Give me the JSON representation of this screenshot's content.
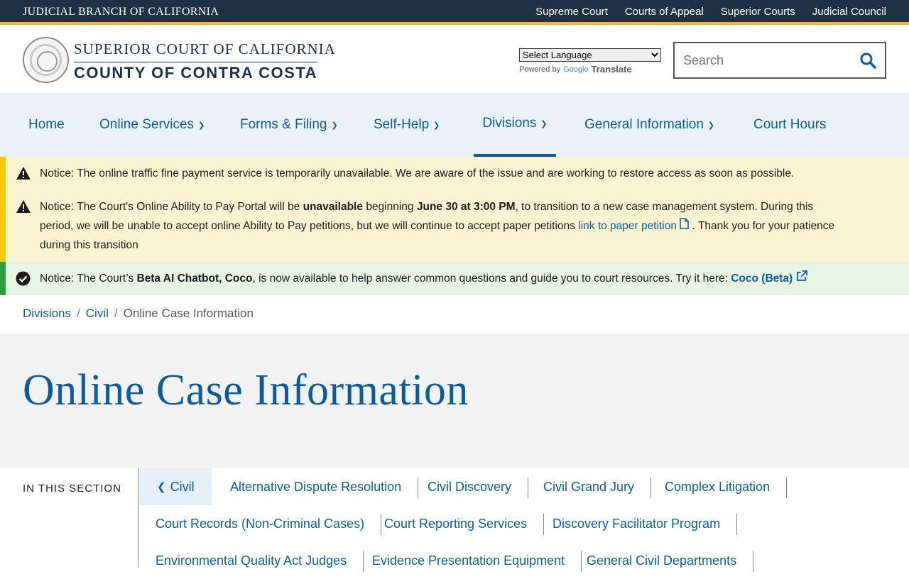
{
  "topbar": {
    "brand": "JUDICIAL BRANCH OF CALIFORNIA",
    "links": [
      "Supreme Court",
      "Courts of Appeal",
      "Superior Courts",
      "Judicial Council"
    ]
  },
  "header": {
    "court_line1": "SUPERIOR COURT OF CALIFORNIA",
    "court_line2": "COUNTY OF CONTRA COSTA",
    "language_select": "Select Language",
    "powered_by": "Powered by",
    "google": "Google",
    "translate": "Translate",
    "search_placeholder": "Search"
  },
  "nav": {
    "items": [
      "Home",
      "Online Services",
      "Forms & Filing",
      "Self-Help",
      "Divisions",
      "General Information",
      "Court Hours"
    ],
    "active": "Divisions"
  },
  "notices": {
    "n1": {
      "label": "Notice:",
      "text": "The online traffic fine payment service is temporarily unavailable. We are aware of the issue and are working to restore access as soon as possible."
    },
    "n2": {
      "label": "Notice:",
      "text_a": "The Court's Online Ability to Pay Portal will be",
      "bold1": "unavailable",
      "text_b": "beginning",
      "bold2": "June 30 at 3:00 PM",
      "text_c": ", to transition to a new case management system. During this period, we will be unable to accept online Ability to Pay petitions, but we will continue to accept paper petitions",
      "link": "link to paper petition",
      "text_d": ". Thank you for your patience during this transition"
    },
    "n3": {
      "label": "Notice:",
      "text_a": "The Court’s",
      "bold": "Beta AI Chatbot, Coco",
      "text_b": ", is now available to help answer common questions and guide you to court resources. Try it here:",
      "link": "Coco (Beta)"
    }
  },
  "breadcrumb": {
    "items": [
      "Divisions",
      "Civil",
      "Online Case Information"
    ]
  },
  "page_title": "Online Case Information",
  "in_this_section": {
    "label": "IN THIS SECTION",
    "back": "Civil",
    "links": [
      "Alternative Dispute Resolution",
      "Civil Discovery",
      "Civil Grand Jury",
      "Complex Litigation",
      "Court Records (Non-Criminal Cases)",
      "Court Reporting Services",
      "Discovery Facilitator Program",
      "Environmental Quality Act Judges",
      "Evidence Presentation Equipment",
      "General Civil Departments"
    ]
  },
  "colors": {
    "navy": "#1f3144",
    "accent_gold": "#f2b632",
    "link_blue": "#0c5d97",
    "nav_bg": "#ebf1f8",
    "warning_bg": "#faf3d1",
    "success_bg": "#e7f4e4"
  }
}
